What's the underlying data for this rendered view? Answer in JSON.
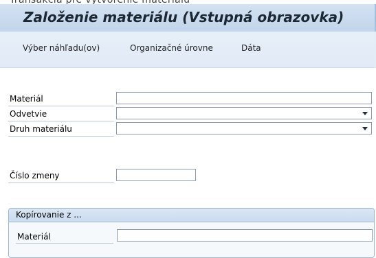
{
  "window": {
    "top_partial_text": "Transakcia pre vytvorenie materiálu",
    "title": "Založenie materiálu (Vstupná obrazovka)"
  },
  "menu": {
    "items": [
      {
        "label": "Výber náhľadu(ov)"
      },
      {
        "label": "Organizačné úrovne"
      },
      {
        "label": "Dáta"
      }
    ]
  },
  "form": {
    "material": {
      "label": "Materiál",
      "value": ""
    },
    "industry": {
      "label": "Odvetvie",
      "value": ""
    },
    "material_type": {
      "label": "Druh materiálu",
      "value": ""
    },
    "change_number": {
      "label": "Číslo zmeny",
      "value": ""
    }
  },
  "copy_from": {
    "title": "Kopírovanie z ...",
    "material": {
      "label": "Materiál",
      "value": ""
    }
  }
}
